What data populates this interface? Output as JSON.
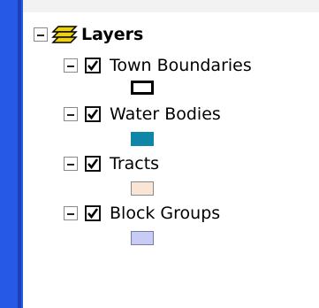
{
  "toc": {
    "root": {
      "label": "Layers",
      "icon": "layers-icon",
      "icon_color": "#f0d400"
    },
    "layers": [
      {
        "name": "Town Boundaries",
        "checked": true,
        "symbol": {
          "fill": "#ffffff",
          "outline": "#000000"
        }
      },
      {
        "name": "Water Bodies",
        "checked": true,
        "symbol": {
          "fill": "#0e86a8",
          "outline": "#0e86a8"
        }
      },
      {
        "name": "Tracts",
        "checked": true,
        "symbol": {
          "fill": "#fae4d3",
          "outline": "#8a8a8a"
        }
      },
      {
        "name": "Block Groups",
        "checked": true,
        "symbol": {
          "fill": "#c8ccf4",
          "outline": "#7a7ab0"
        }
      }
    ]
  },
  "colors": {
    "window_border": "#2659e6",
    "background": "#ffffff"
  }
}
